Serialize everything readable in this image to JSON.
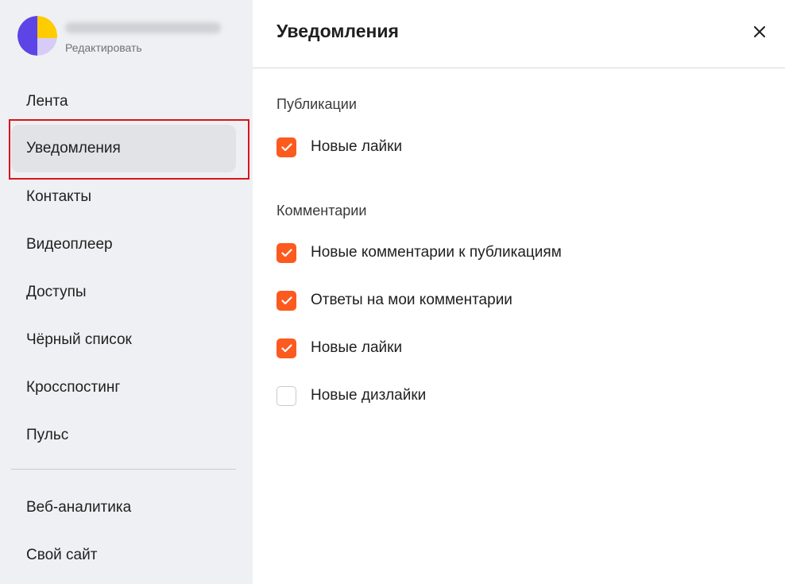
{
  "sidebar": {
    "profile": {
      "edit_label": "Редактировать"
    },
    "items": [
      {
        "label": "Лента"
      },
      {
        "label": "Уведомления"
      },
      {
        "label": "Контакты"
      },
      {
        "label": "Видеоплеер"
      },
      {
        "label": "Доступы"
      },
      {
        "label": "Чёрный список"
      },
      {
        "label": "Кросспостинг"
      },
      {
        "label": "Пульс"
      },
      {
        "label": "Веб-аналитика"
      },
      {
        "label": "Свой сайт"
      }
    ],
    "active_index": 1
  },
  "main": {
    "title": "Уведомления",
    "close_icon": "close-icon",
    "sections": [
      {
        "title": "Публикации",
        "options": [
          {
            "label": "Новые лайки",
            "checked": true
          }
        ]
      },
      {
        "title": "Комментарии",
        "options": [
          {
            "label": "Новые комментарии к публикациям",
            "checked": true
          },
          {
            "label": "Ответы на мои комментарии",
            "checked": true
          },
          {
            "label": "Новые лайки",
            "checked": true
          },
          {
            "label": "Новые дизлайки",
            "checked": false
          }
        ]
      }
    ]
  },
  "colors": {
    "accent": "#fc5a1e",
    "sidebar_bg": "#eff0f3",
    "active_item_bg": "#e1e3e7",
    "highlight_border": "#d9141d"
  }
}
